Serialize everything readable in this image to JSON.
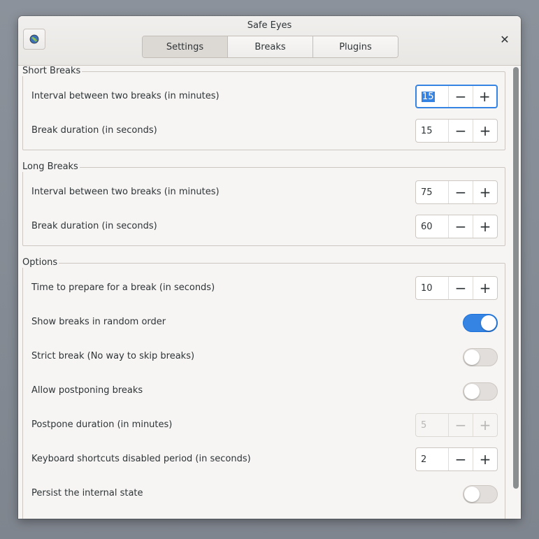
{
  "window": {
    "title": "Safe Eyes"
  },
  "tabs": [
    {
      "label": "Settings",
      "active": true
    },
    {
      "label": "Breaks",
      "active": false
    },
    {
      "label": "Plugins",
      "active": false
    }
  ],
  "short_breaks": {
    "label": "Short Breaks",
    "interval_label": "Interval between two breaks (in minutes)",
    "interval_value": "15",
    "duration_label": "Break duration (in seconds)",
    "duration_value": "15"
  },
  "long_breaks": {
    "label": "Long Breaks",
    "interval_label": "Interval between two breaks (in minutes)",
    "interval_value": "75",
    "duration_label": "Break duration (in seconds)",
    "duration_value": "60"
  },
  "options": {
    "label": "Options",
    "prepare_label": "Time to prepare for a break (in seconds)",
    "prepare_value": "10",
    "random_order_label": "Show breaks in random order",
    "random_order_on": true,
    "strict_label": "Strict break (No way to skip breaks)",
    "strict_on": false,
    "postpone_label": "Allow postponing breaks",
    "postpone_on": false,
    "postpone_duration_label": "Postpone duration (in minutes)",
    "postpone_duration_value": "5",
    "shortcuts_label": "Keyboard shortcuts disabled period (in seconds)",
    "shortcuts_value": "2",
    "persist_label": "Persist the internal state",
    "persist_on": false
  },
  "spin": {
    "minus": "−",
    "plus": "+"
  },
  "icons": {
    "about": "globe-icon",
    "close": "close-icon"
  },
  "colors": {
    "accent": "#3584e4"
  }
}
